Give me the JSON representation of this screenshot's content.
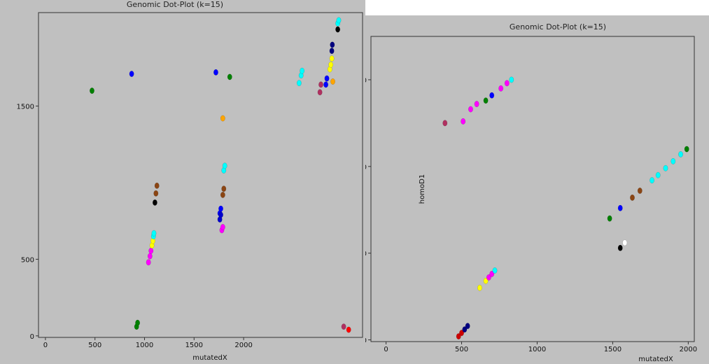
{
  "chart_data": [
    {
      "type": "scatter",
      "title": "Genomic Dot-Plot (k=15)",
      "xlabel": "mutatedX",
      "ylabel": "",
      "xlim": [
        -70,
        3200
      ],
      "ylim": [
        -10,
        2110
      ],
      "x_ticks": [
        "0",
        "500",
        "1000",
        "1500",
        "2000"
      ],
      "y_ticks": [
        "0",
        "500",
        "1500"
      ],
      "series": [
        {
          "color": "#008000",
          "points": [
            [
              920,
              60
            ],
            [
              930,
              85
            ]
          ]
        },
        {
          "color": "#ff00ff",
          "points": [
            [
              1040,
              480
            ],
            [
              1055,
              520
            ],
            [
              1065,
              555
            ]
          ]
        },
        {
          "color": "#ffff00",
          "points": [
            [
              1075,
              590
            ],
            [
              1085,
              620
            ]
          ]
        },
        {
          "color": "#00ffff",
          "points": [
            [
              1090,
              650
            ],
            [
              1095,
              670
            ]
          ]
        },
        {
          "color": "#000000",
          "points": [
            [
              1105,
              870
            ]
          ]
        },
        {
          "color": "#8b4513",
          "points": [
            [
              1115,
              930
            ],
            [
              1125,
              980
            ]
          ]
        },
        {
          "color": "#0000ff",
          "points": [
            [
              870,
              1710
            ],
            [
              1720,
              1720
            ],
            [
              1760,
              800
            ],
            [
              1770,
              830
            ],
            [
              2830,
              1640
            ],
            [
              2840,
              1680
            ]
          ]
        },
        {
          "color": "#00ffff",
          "points": [
            [
              2560,
              1650
            ],
            [
              2580,
              1700
            ],
            [
              2590,
              1730
            ],
            [
              1800,
              1080
            ],
            [
              1810,
              1110
            ]
          ]
        },
        {
          "color": "#ffa500",
          "points": [
            [
              1790,
              1420
            ],
            [
              2900,
              1660
            ]
          ]
        },
        {
          "color": "#b03060",
          "points": [
            [
              2770,
              1590
            ],
            [
              2780,
              1640
            ],
            [
              3010,
              60
            ]
          ]
        },
        {
          "color": "#ffff00",
          "points": [
            [
              2870,
              1740
            ],
            [
              2880,
              1770
            ],
            [
              2890,
              1810
            ]
          ]
        },
        {
          "color": "#000080",
          "points": [
            [
              2890,
              1860
            ],
            [
              2895,
              1900
            ]
          ]
        },
        {
          "color": "#0000cd",
          "points": [
            [
              1760,
              760
            ],
            [
              1770,
              790
            ]
          ]
        },
        {
          "color": "#8b4513",
          "points": [
            [
              1790,
              920
            ],
            [
              1800,
              960
            ]
          ]
        },
        {
          "color": "#ff00ff",
          "points": [
            [
              1780,
              690
            ],
            [
              1790,
              710
            ]
          ]
        },
        {
          "color": "#008000",
          "points": [
            [
              470,
              1600
            ],
            [
              1860,
              1690
            ]
          ]
        },
        {
          "color": "#000000",
          "points": [
            [
              2950,
              2000
            ]
          ]
        },
        {
          "color": "#00ffff",
          "points": [
            [
              2950,
              2040
            ],
            [
              2960,
              2060
            ]
          ]
        },
        {
          "color": "#ff0000",
          "points": [
            [
              3060,
              40
            ]
          ]
        }
      ]
    },
    {
      "type": "scatter",
      "title": "Genomic Dot-Plot (k=15)",
      "xlabel": "mutatedX",
      "ylabel": "homoD1",
      "xlim": [
        -100,
        2040
      ],
      "ylim": [
        -10,
        1750
      ],
      "x_ticks": [
        "0",
        "500",
        "1000",
        "1500",
        "2000"
      ],
      "y_ticks": [
        "0",
        "500",
        "1000",
        "1500"
      ],
      "series": [
        {
          "color": "#cc0000",
          "points": [
            [
              480,
              20
            ],
            [
              500,
              40
            ]
          ]
        },
        {
          "color": "#000080",
          "points": [
            [
              520,
              60
            ],
            [
              540,
              80
            ]
          ]
        },
        {
          "color": "#ffff00",
          "points": [
            [
              620,
              300
            ],
            [
              660,
              340
            ]
          ]
        },
        {
          "color": "#ff00ff",
          "points": [
            [
              680,
              360
            ],
            [
              700,
              380
            ]
          ]
        },
        {
          "color": "#00ffff",
          "points": [
            [
              720,
              400
            ]
          ]
        },
        {
          "color": "#b03060",
          "points": [
            [
              390,
              1250
            ]
          ]
        },
        {
          "color": "#ff00ff",
          "points": [
            [
              510,
              1260
            ],
            [
              560,
              1330
            ],
            [
              600,
              1360
            ]
          ]
        },
        {
          "color": "#008000",
          "points": [
            [
              660,
              1380
            ]
          ]
        },
        {
          "color": "#0000ff",
          "points": [
            [
              700,
              1410
            ]
          ]
        },
        {
          "color": "#ff00ff",
          "points": [
            [
              760,
              1450
            ],
            [
              800,
              1480
            ]
          ]
        },
        {
          "color": "#00ffff",
          "points": [
            [
              830,
              1500
            ]
          ]
        },
        {
          "color": "#ffffff",
          "points": [
            [
              1580,
              560
            ]
          ]
        },
        {
          "color": "#000000",
          "points": [
            [
              1550,
              530
            ]
          ]
        },
        {
          "color": "#008000",
          "points": [
            [
              1480,
              700
            ]
          ]
        },
        {
          "color": "#0000ff",
          "points": [
            [
              1550,
              760
            ]
          ]
        },
        {
          "color": "#8b4513",
          "points": [
            [
              1630,
              820
            ],
            [
              1680,
              860
            ]
          ]
        },
        {
          "color": "#00ffff",
          "points": [
            [
              1760,
              920
            ],
            [
              1800,
              950
            ],
            [
              1850,
              990
            ],
            [
              1900,
              1030
            ],
            [
              1950,
              1070
            ]
          ]
        },
        {
          "color": "#008000",
          "points": [
            [
              1990,
              1100
            ]
          ]
        }
      ]
    }
  ]
}
